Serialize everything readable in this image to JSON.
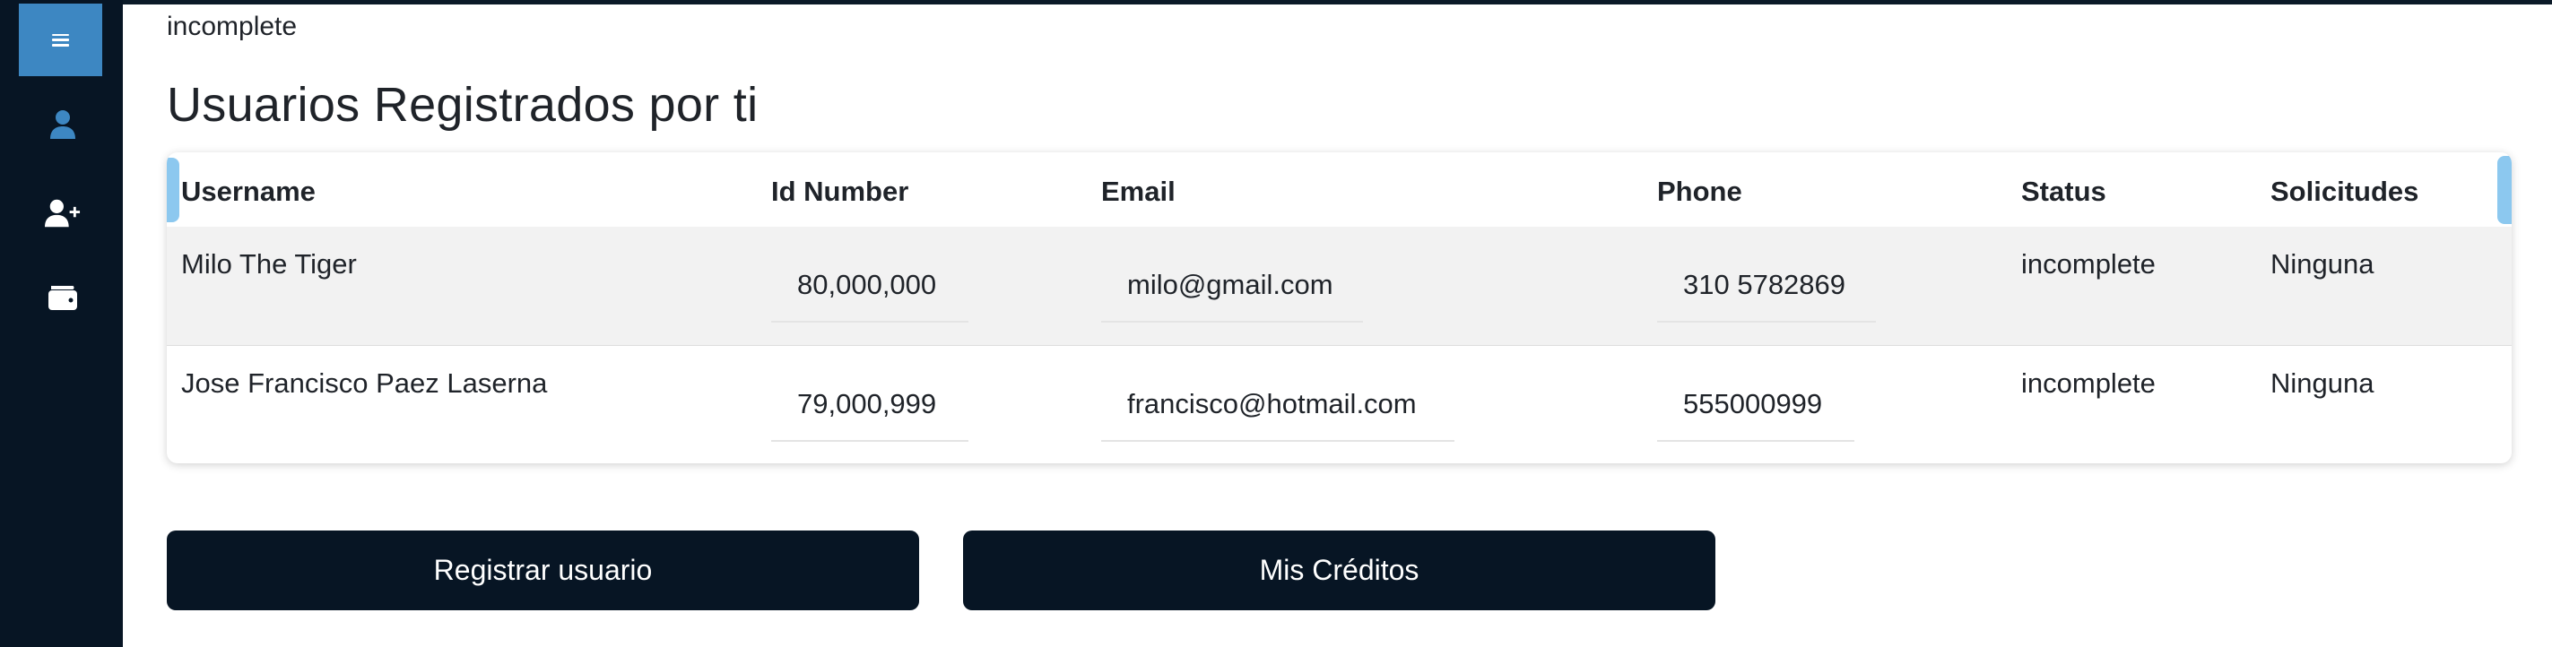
{
  "sidebar": {
    "items": [
      {
        "name": "menu-icon"
      },
      {
        "name": "user-icon"
      },
      {
        "name": "add-user-icon"
      },
      {
        "name": "wallet-icon"
      }
    ]
  },
  "main": {
    "top_status": "incomplete",
    "title": "Usuarios Registrados por ti"
  },
  "table": {
    "headers": [
      "Username",
      "Id Number",
      "Email",
      "Phone",
      "Status",
      "Solicitudes"
    ],
    "rows": [
      {
        "username": "Milo The Tiger",
        "id_number": "80,000,000",
        "email": "milo@gmail.com",
        "phone": "310 5782869",
        "status": "incomplete",
        "solicitudes": "Ninguna"
      },
      {
        "username": "Jose Francisco Paez Laserna",
        "id_number": "79,000,999",
        "email": "francisco@hotmail.com",
        "phone": "555000999",
        "status": "incomplete",
        "solicitudes": "Ninguna"
      }
    ]
  },
  "actions": {
    "register_label": "Registrar usuario",
    "credits_label": "Mis Créditos"
  },
  "colors": {
    "sidebar_bg": "#071524",
    "menu_active": "#3d87c2",
    "active_icon": "#3d87c2",
    "button_bg": "#071524",
    "scroll_indicator": "#8cc8ef",
    "row_alt_bg": "#f2f2f2"
  }
}
